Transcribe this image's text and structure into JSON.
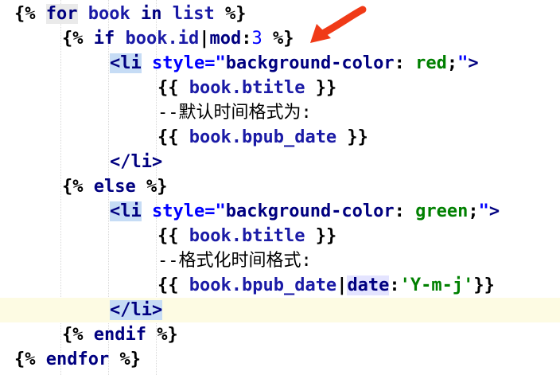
{
  "code_lines": [
    "{% for book in list %}",
    "{% if book.id|mod:3 %}",
    "<li style=\"background-color: red;\">",
    "{{ book.btitle }}",
    "--默认时间格式为:",
    "{{ book.bpub_date }}",
    "</li>",
    "{% else %}",
    "<li style=\"background-color: green;\">",
    "{{ book.btitle }}",
    "--格式化时间格式:",
    "{{ book.bpub_date|date:'Y-m-j'}}",
    "</li>",
    "{% endif %}",
    "{% endfor %}"
  ],
  "tokens": {
    "l1": {
      "open": "{% ",
      "kw": "for",
      "s1": " ",
      "v1": "book",
      "s2": " ",
      "kw2": "in",
      "s3": " ",
      "v2": "list",
      "close": " %}"
    },
    "l2": {
      "open": "{% ",
      "kw": "if",
      "s1": " ",
      "v1": "book.id",
      "pipe": "|",
      "f": "mod",
      "colon": ":",
      "num": "3",
      "close": " %}"
    },
    "l3": {
      "lt": "<",
      "tag": "li",
      "sp": " ",
      "attr": "style=",
      "q1": "\"",
      "prop": "background-color",
      "c": ": ",
      "val": "red",
      "semi": ";",
      "q2": "\"",
      "gt": ">"
    },
    "l4": {
      "open": "{{ ",
      "v": "book.btitle",
      "close": " }}"
    },
    "l5": {
      "text": "--默认时间格式为:"
    },
    "l6": {
      "open": "{{ ",
      "v": "book.bpub_date",
      "close": " }}"
    },
    "l7": {
      "tag": "</li>"
    },
    "l8": {
      "open": "{% ",
      "kw": "else",
      "close": " %}"
    },
    "l9": {
      "lt": "<",
      "tag": "li",
      "sp": " ",
      "attr": "style=",
      "q1": "\"",
      "prop": "background-color",
      "c": ": ",
      "val": "green",
      "semi": ";",
      "q2": "\"",
      "gt": ">"
    },
    "l10": {
      "open": "{{ ",
      "v": "book.btitle",
      "close": " }}"
    },
    "l11": {
      "text": "--格式化时间格式:"
    },
    "l12": {
      "open": "{{ ",
      "v": "book.bpub_date",
      "pipe": "|",
      "f": "date",
      "colon": ":",
      "str": "'Y-m-j'",
      "close": "}}"
    },
    "l13": {
      "tag": "</li>"
    },
    "l14": {
      "open": "{% ",
      "kw": "endif",
      "close": " %}"
    },
    "l15": {
      "open": "{% ",
      "kw": "endfor",
      "close": " %}"
    }
  },
  "annotation": {
    "icon": "red-arrow-icon",
    "color": "#f03a17"
  }
}
